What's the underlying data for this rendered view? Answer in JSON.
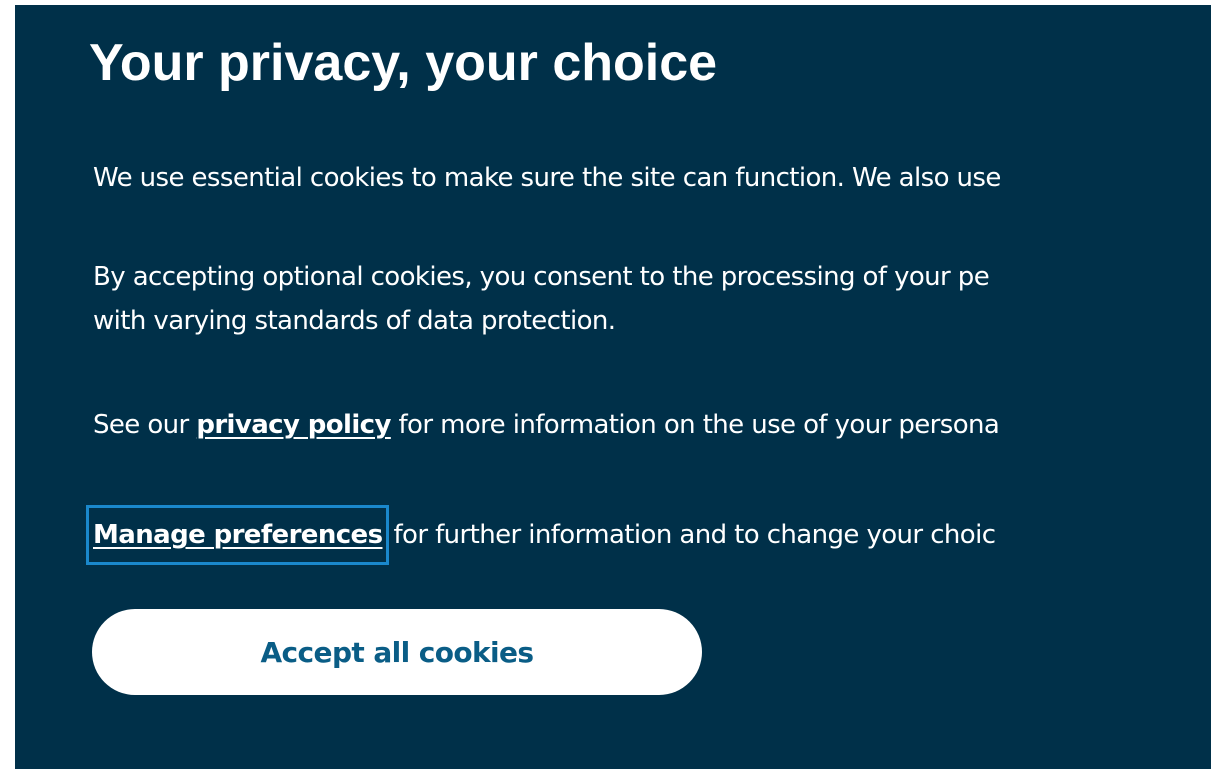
{
  "banner": {
    "title": "Your privacy, your choice",
    "paragraph1": "We use essential cookies to make sure the site can function. We also use",
    "paragraph2_line1": "By accepting optional cookies, you consent to the processing of your pe",
    "paragraph2_line2": "with varying standards of data protection.",
    "privacy_prefix": "See our ",
    "privacy_link": "privacy policy",
    "privacy_suffix": " for more information on the use of your persona",
    "manage_link": "Manage preferences",
    "manage_suffix": "for further information and to change your choic",
    "accept_button": "Accept all cookies"
  },
  "colors": {
    "background": "#003049",
    "text": "#ffffff",
    "button_background": "#ffffff",
    "button_text": "#0a5d86",
    "focus_outline": "#1a88cc"
  }
}
